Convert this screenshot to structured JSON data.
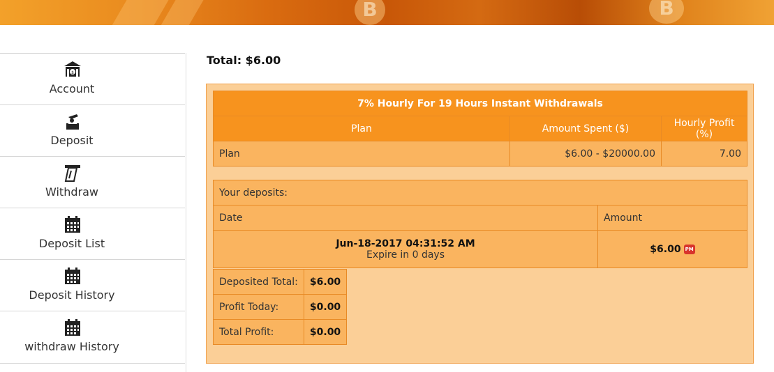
{
  "sidebar": {
    "items": [
      {
        "label": "Account",
        "icon": "bank-dollar-icon"
      },
      {
        "label": "Deposit",
        "icon": "deposit-hand-icon"
      },
      {
        "label": "Withdraw",
        "icon": "withdraw-atm-icon"
      },
      {
        "label": "Deposit List",
        "icon": "calendar-icon"
      },
      {
        "label": "Deposit History",
        "icon": "calendar-icon"
      },
      {
        "label": "withdraw History",
        "icon": "calendar-icon"
      }
    ]
  },
  "total": "Total: $6.00",
  "plan_table": {
    "title": "7% Hourly For 19 Hours Instant Withdrawals",
    "headers": [
      "Plan",
      "Amount Spent ($)",
      "Hourly Profit (%)"
    ],
    "row": [
      "Plan",
      "$6.00 - $20000.00",
      "7.00"
    ]
  },
  "deposits": {
    "label": "Your deposits:",
    "headers": [
      "Date",
      "Amount"
    ],
    "entry": {
      "date": "Jun-18-2017 04:31:52 AM",
      "expire": "Expire in 0 days",
      "amount": "$6.00",
      "processor_badge": "PM"
    }
  },
  "summary": [
    {
      "label": "Deposited Total:",
      "value": "$6.00"
    },
    {
      "label": "Profit Today:",
      "value": "$0.00"
    },
    {
      "label": "Total Profit:",
      "value": "$0.00"
    }
  ],
  "colors": {
    "header": "#f7931e",
    "cell": "#fab45f",
    "panel": "#fbcf97",
    "border": "#e88a25",
    "badge": "#d8342c"
  }
}
